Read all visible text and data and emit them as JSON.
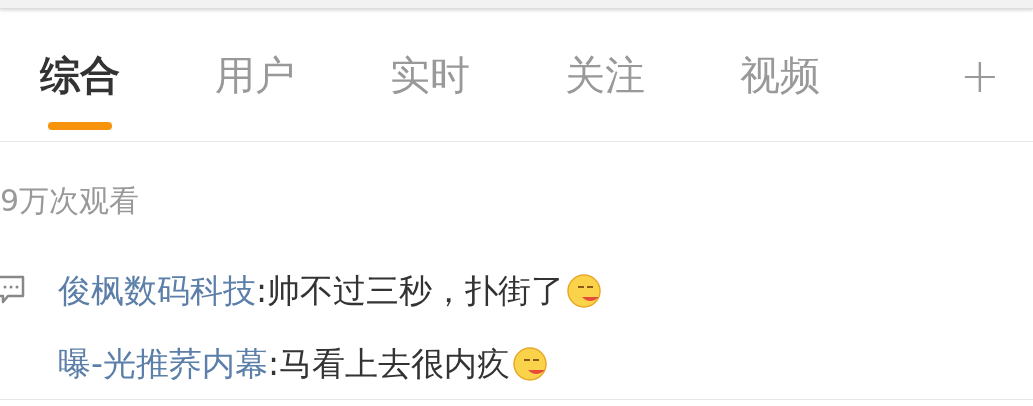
{
  "tabs": [
    {
      "label": "综合",
      "selected": true
    },
    {
      "label": "用户",
      "selected": false
    },
    {
      "label": "实时",
      "selected": false
    },
    {
      "label": "关注",
      "selected": false
    },
    {
      "label": "视频",
      "selected": false
    }
  ],
  "add_tab": "+",
  "view_count": "9万次观看",
  "comments": [
    {
      "user": "俊枫数码科技",
      "text": ":帅不过三秒，扑街了"
    },
    {
      "user": "曝-光推荞内幕",
      "text": ":马看上去很内疚"
    }
  ]
}
